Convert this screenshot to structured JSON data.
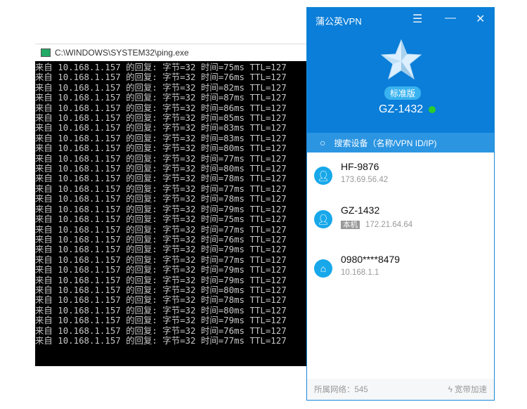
{
  "console": {
    "title": "C:\\WINDOWS\\SYSTEM32\\ping.exe",
    "line_prefix": "来自 10.168.1.157 的回复: 字节=32 时间=",
    "line_suffix": "ms TTL=127",
    "times": [
      75,
      76,
      82,
      87,
      86,
      85,
      83,
      83,
      80,
      77,
      80,
      78,
      77,
      78,
      79,
      75,
      77,
      76,
      79,
      77,
      79,
      79,
      80,
      78,
      80,
      79,
      76,
      77
    ]
  },
  "vpn": {
    "title": "蒲公英VPN",
    "edition": "标准版",
    "device": "GZ-1432",
    "search_placeholder": "搜索设备（名称/VPN ID/IP)",
    "devices": [
      {
        "name": "HF-9876",
        "ip": "173.69.56.42"
      },
      {
        "name": "GZ-1432",
        "tag": "本机",
        "ip": "172.21.64.64"
      },
      {
        "name": "0980****8479",
        "ip": "10.168.1.1"
      }
    ],
    "footer": {
      "network": "所属网络：545",
      "boost": "宽带加速"
    },
    "accent": "#0a7ed8"
  }
}
